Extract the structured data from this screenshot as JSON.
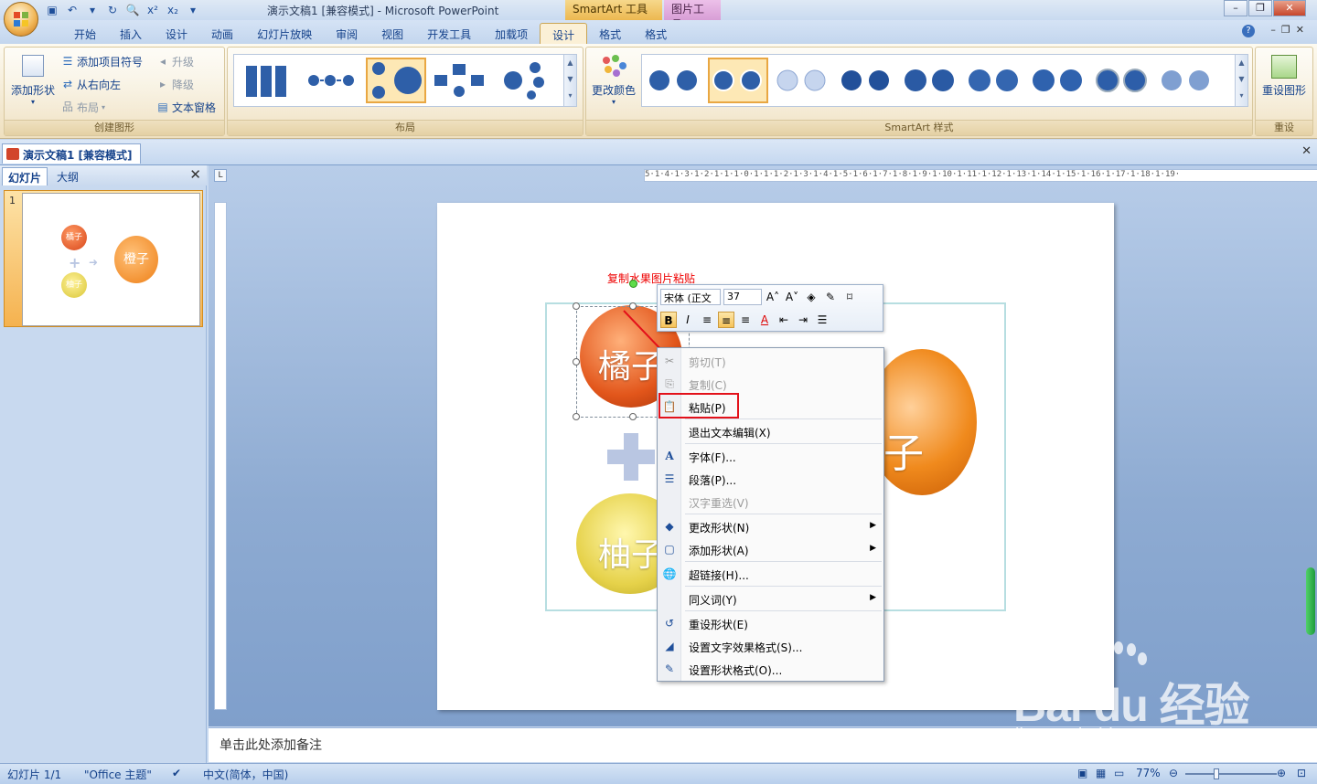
{
  "titlebar": {
    "title": "演示文稿1 [兼容模式] - Microsoft PowerPoint",
    "ctx_smartart": "SmartArt 工具",
    "ctx_picture": "图片工具"
  },
  "tabs": [
    {
      "label": "开始"
    },
    {
      "label": "插入"
    },
    {
      "label": "设计"
    },
    {
      "label": "动画"
    },
    {
      "label": "幻灯片放映"
    },
    {
      "label": "审阅"
    },
    {
      "label": "视图"
    },
    {
      "label": "开发工具"
    },
    {
      "label": "加载项"
    },
    {
      "label": "设计"
    },
    {
      "label": "格式"
    },
    {
      "label": "格式"
    }
  ],
  "ribbon": {
    "create": {
      "add_shape": "添加形状",
      "add_bullet": "添加项目符号",
      "rtl": "从右向左",
      "layout": "布局",
      "promote": "升级",
      "demote": "降级",
      "text_pane": "文本窗格",
      "label": "创建图形"
    },
    "layouts_label": "布局",
    "change_colors": "更改颜色",
    "styles_label": "SmartArt 样式",
    "reset_graphic": "重设图形",
    "reset_label": "重设"
  },
  "doc": {
    "tab": "演示文稿1 [兼容模式]"
  },
  "leftpane": {
    "tab_slides": "幻灯片",
    "tab_outline": "大纲",
    "slide_number": "1",
    "thumb": {
      "orange": "橘子",
      "pomelo": "柚子",
      "result": "橙子"
    }
  },
  "ruler": {
    "h": "5·1·4·1·3·1·2·1·1·1·0·1·1·1·2·1·3·1·4·1·5·1·6·1·7·1·8·1·9·1·10·1·11·1·12·1·13·1·14·1·15·1·16·1·17·1·18·1·19·"
  },
  "slide": {
    "annotation": "复制水果图片粘贴",
    "fruit_orange": "橘子",
    "fruit_pomelo": "柚子",
    "fruit_result": "子"
  },
  "minitoolbar": {
    "font": "宋体 (正文",
    "size": "37"
  },
  "contextmenu": {
    "items": [
      {
        "label": "剪切(T)",
        "disabled": true
      },
      {
        "label": "复制(C)",
        "disabled": true
      },
      {
        "label": "粘贴(P)",
        "disabled": false
      },
      {
        "label": "退出文本编辑(X)",
        "disabled": false
      },
      {
        "label": "字体(F)...",
        "disabled": false
      },
      {
        "label": "段落(P)...",
        "disabled": false
      },
      {
        "label": "汉字重选(V)",
        "disabled": true
      },
      {
        "label": "更改形状(N)",
        "disabled": false
      },
      {
        "label": "添加形状(A)",
        "disabled": false
      },
      {
        "label": "超链接(H)...",
        "disabled": false
      },
      {
        "label": "同义词(Y)",
        "disabled": false
      },
      {
        "label": "重设形状(E)",
        "disabled": false
      },
      {
        "label": "设置文字效果格式(S)...",
        "disabled": false
      },
      {
        "label": "设置形状格式(O)...",
        "disabled": false
      }
    ]
  },
  "notes": {
    "placeholder": "单击此处添加备注"
  },
  "status": {
    "slide": "幻灯片 1/1",
    "theme": "\"Office 主题\"",
    "language": "中文(简体，中国)",
    "zoom": "77%"
  },
  "watermark": {
    "text": "Bai du 经验",
    "sub": "jingyan.baidu.com"
  },
  "colors": {
    "accent_context_smartart": "#ecb850",
    "accent_context_picture": "#d89ed6",
    "highlight_red": "#e3111a"
  }
}
